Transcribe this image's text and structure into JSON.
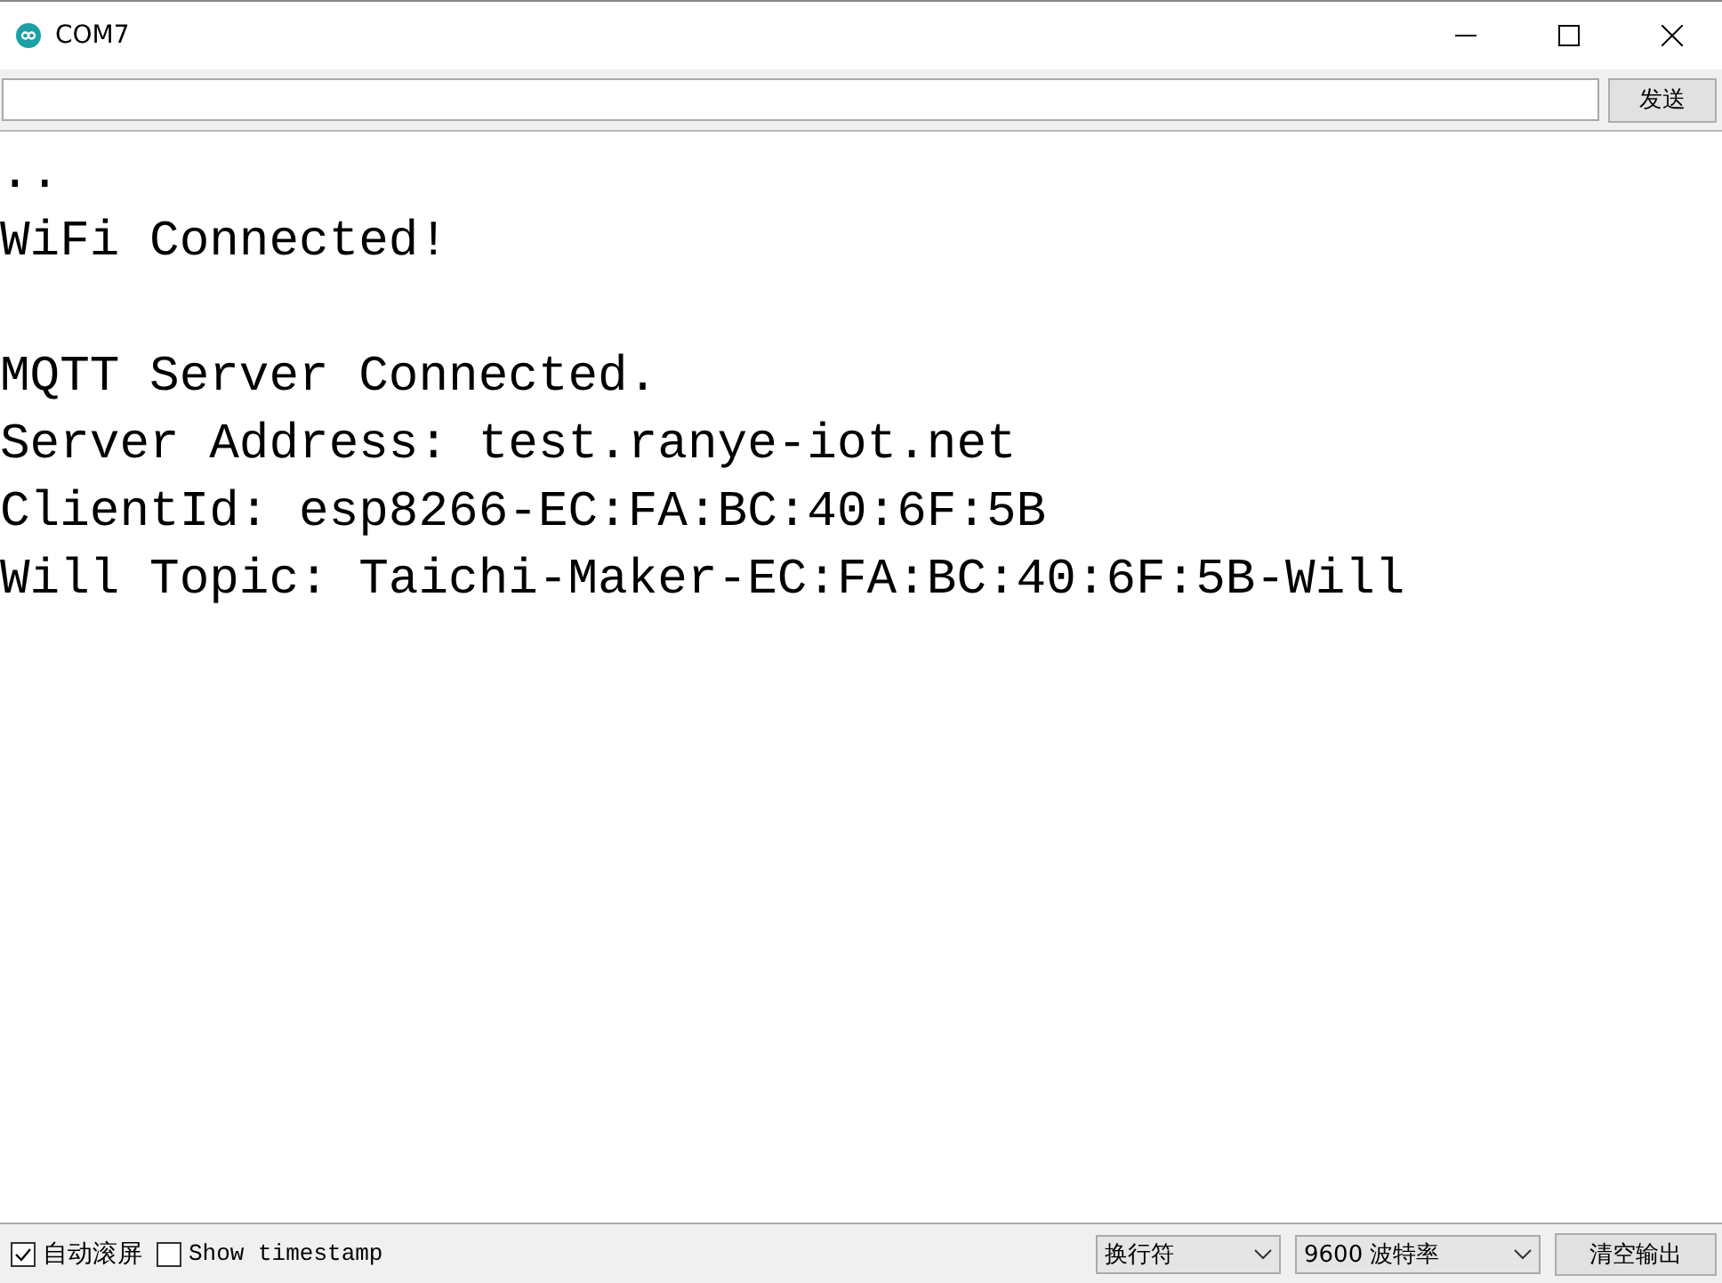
{
  "window": {
    "title": "COM7"
  },
  "input": {
    "send_button": "发送"
  },
  "output_blocks": [
    [
      "..",
      "WiFi Connected!"
    ],
    [
      "MQTT Server Connected.",
      "Server Address: test.ranye-iot.net",
      "ClientId: esp8266-EC:FA:BC:40:6F:5B",
      "Will Topic: Taichi-Maker-EC:FA:BC:40:6F:5B-Will"
    ]
  ],
  "status_bar": {
    "checkboxes": [
      {
        "label": "自动滚屏",
        "checked": true
      },
      {
        "label": "Show timestamp",
        "checked": false,
        "kind": "mono"
      }
    ],
    "line_ending": "换行符",
    "baud": "9600 波特率",
    "clear_button": "清空输出"
  }
}
